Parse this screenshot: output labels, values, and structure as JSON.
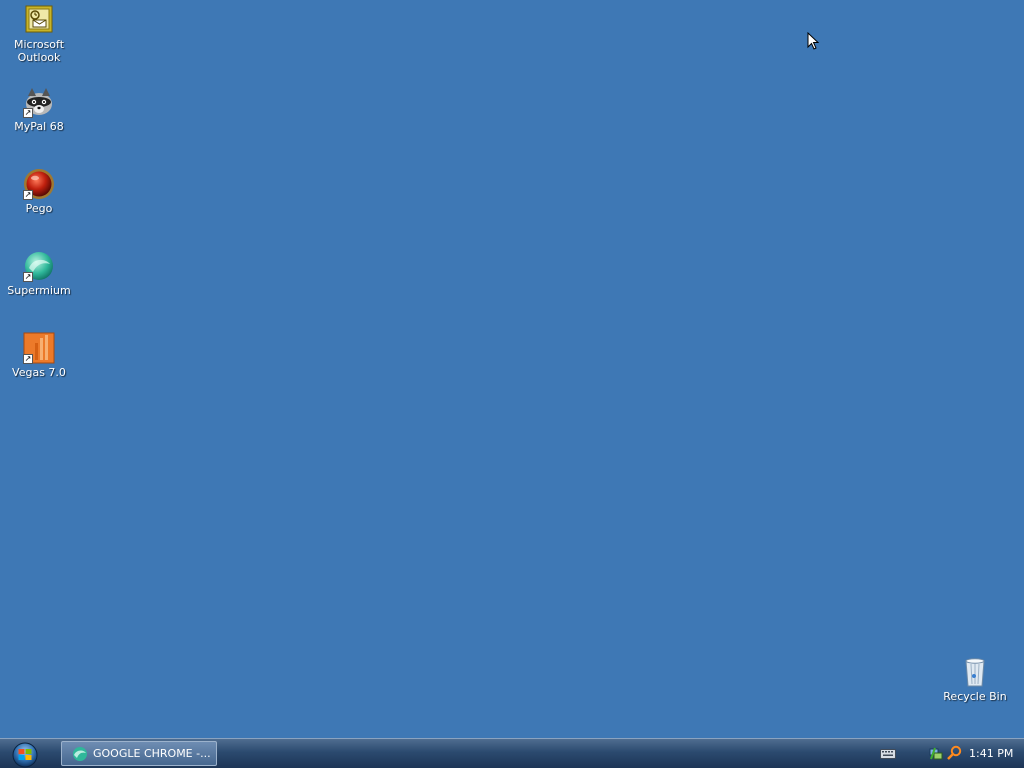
{
  "desktop": {
    "icons": [
      {
        "label": "Microsoft\nOutlook",
        "icon": "outlook-icon"
      },
      {
        "label": "MyPal 68",
        "icon": "mypal-raccoon-icon"
      },
      {
        "label": "Pego",
        "icon": "pego-icon"
      },
      {
        "label": "Supermium",
        "icon": "supermium-icon"
      },
      {
        "label": "Vegas 7.0",
        "icon": "vegas-icon"
      },
      {
        "label": "Recycle Bin",
        "icon": "recycle-bin-icon"
      }
    ],
    "background_color": "#3e78b5"
  },
  "taskbar": {
    "start_icon": "windows-orb-icon",
    "tasks": [
      {
        "label": "GOOGLE CHROME -...",
        "icon": "chrome-icon"
      }
    ],
    "tray": {
      "icons": [
        "keyboard-icon",
        "network-icon",
        "search-icon"
      ],
      "clock": "1:41 PM"
    }
  }
}
